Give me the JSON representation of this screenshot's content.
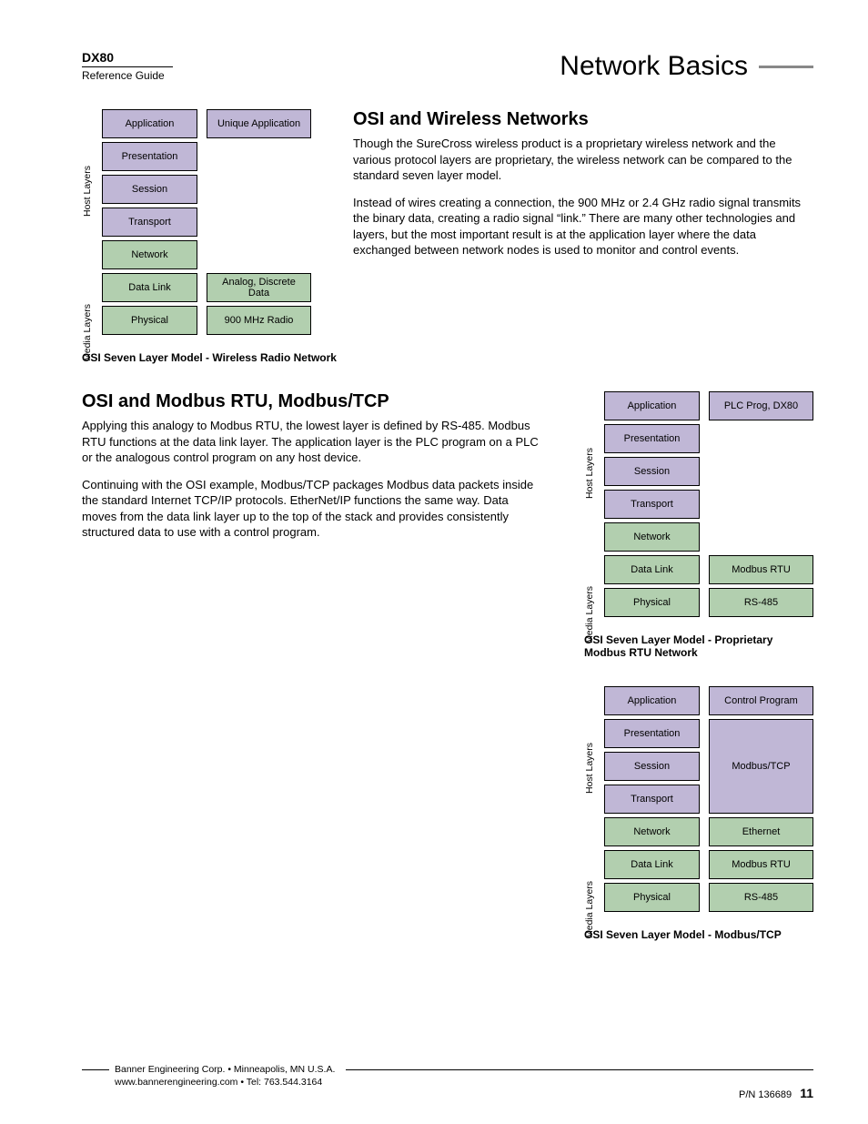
{
  "header": {
    "product": "DX80",
    "guide": "Reference Guide",
    "page_title": "Network Basics"
  },
  "section1": {
    "heading": "OSI and Wireless Networks",
    "para1": "Though the SureCross wireless product is a proprietary wireless network and the various protocol layers are proprietary, the wireless network can be compared to the standard seven layer model.",
    "para2": "Instead of wires creating a connection, the 900 MHz or 2.4 GHz radio signal transmits the binary data, creating a radio signal “link.” There are many other technologies and layers, but the most important result is at the application layer where the data exchanged between network nodes is used to monitor and control events."
  },
  "diagram1": {
    "host_label": "Host Layers",
    "media_label": "Media Layers",
    "col1": [
      "Application",
      "Presentation",
      "Session",
      "Transport",
      "Network",
      "Data Link",
      "Physical"
    ],
    "col2": {
      "top": "Unique Application",
      "dlink": "Analog, Discrete Data",
      "phys": "900 MHz Radio"
    },
    "caption": "OSI Seven Layer Model - Wireless Radio Network"
  },
  "section2": {
    "heading": "OSI and Modbus RTU, Modbus/TCP",
    "para1": "Applying this analogy to Modbus RTU, the lowest layer is defined by RS-485. Modbus RTU functions at the data link layer. The application layer is the PLC program on a PLC or the analogous control program on any host device.",
    "para2": "Continuing with the OSI example, Modbus/TCP packages Modbus data packets inside the standard Internet TCP/IP protocols. EtherNet/IP functions the same way. Data moves from the data link layer up to the top of the stack and provides consistently structured data to use with a control program."
  },
  "diagram2": {
    "host_label": "Host Layers",
    "media_label": "Media Layers",
    "col1": [
      "Application",
      "Presentation",
      "Session",
      "Transport",
      "Network",
      "Data Link",
      "Physical"
    ],
    "col2": {
      "app": "PLC Prog, DX80",
      "dlink": "Modbus RTU",
      "phys": "RS-485"
    },
    "caption": "OSI Seven Layer Model - Proprietary Modbus RTU Network"
  },
  "diagram3": {
    "host_label": "Host Layers",
    "media_label": "Media Layers",
    "col1": [
      "Application",
      "Presentation",
      "Session",
      "Transport",
      "Network",
      "Data Link",
      "Physical"
    ],
    "col2": {
      "app": "Control Program",
      "mid": "Modbus/TCP",
      "net": "Ethernet",
      "dlink": "Modbus RTU",
      "phys": "RS-485"
    },
    "caption": "OSI Seven Layer Model - Modbus/TCP"
  },
  "footer": {
    "line1": "Banner Engineering Corp. • Minneapolis, MN U.S.A.",
    "line2": "www.bannerengineering.com • Tel: 763.544.3164",
    "pn_label": "P/N 136689",
    "page_num": "11"
  }
}
